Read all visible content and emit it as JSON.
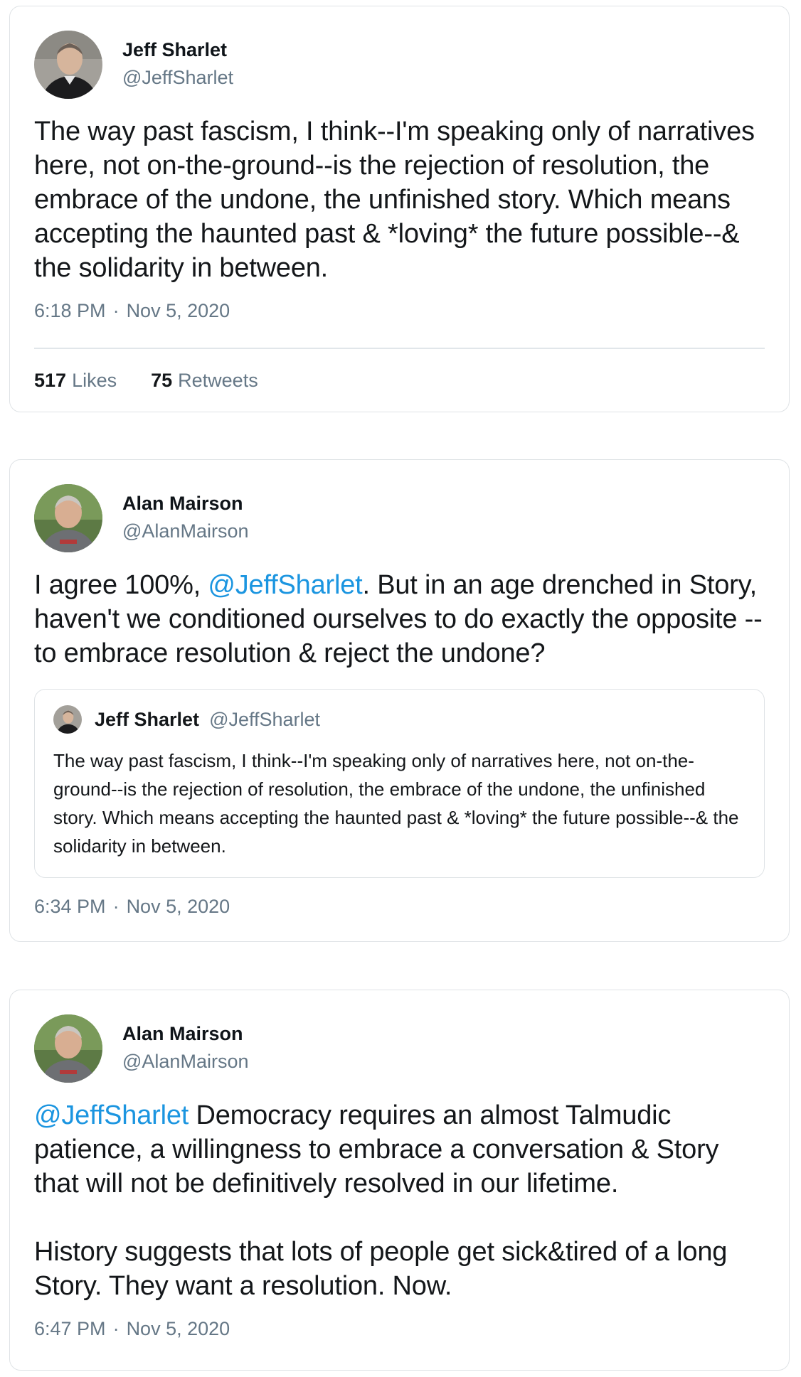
{
  "tweets": [
    {
      "display_name": "Jeff Sharlet",
      "handle": "@JeffSharlet",
      "avatar_icon": "person-avatar-icon",
      "text": "The way past fascism, I think--I'm speaking only of narratives here, not on-the-ground--is the rejection of resolution, the embrace of the undone, the unfinished story. Which means accepting the haunted past & *loving* the future possible--& the solidarity in between.",
      "time": "6:18 PM",
      "separator": "·",
      "date": "Nov 5, 2020",
      "likes_count": "517",
      "likes_label": "Likes",
      "retweets_count": "75",
      "retweets_label": "Retweets"
    },
    {
      "display_name": "Alan Mairson",
      "handle": "@AlanMairson",
      "avatar_icon": "person-avatar-icon",
      "text_before": "I agree 100%, ",
      "mention": "@JeffSharlet",
      "text_after": ". But in an age drenched in Story, haven't we conditioned ourselves to do exactly the opposite -- to embrace resolution & reject the undone?",
      "quote": {
        "display_name": "Jeff Sharlet",
        "handle": "@JeffSharlet",
        "text": "The way past fascism, I think--I'm speaking only of narratives here, not on-the-ground--is the rejection of resolution, the embrace of the undone, the unfinished story. Which means accepting the haunted past & *loving* the future possible--& the solidarity in between."
      },
      "time": "6:34 PM",
      "separator": "·",
      "date": "Nov 5, 2020"
    },
    {
      "display_name": "Alan Mairson",
      "handle": "@AlanMairson",
      "avatar_icon": "person-avatar-icon",
      "mention": "@JeffSharlet",
      "text_after": " Democracy requires an almost Talmudic patience, a willingness to embrace a conversation & Story that will not be definitively resolved in our lifetime.\n\nHistory suggests that lots of people get sick&tired of a long Story. They want a resolution. Now.",
      "time": "6:47 PM",
      "separator": "·",
      "date": "Nov 5, 2020"
    }
  ],
  "colors": {
    "mention": "#1b95e0",
    "secondary_text": "#657786",
    "border": "#dfe3e6"
  }
}
